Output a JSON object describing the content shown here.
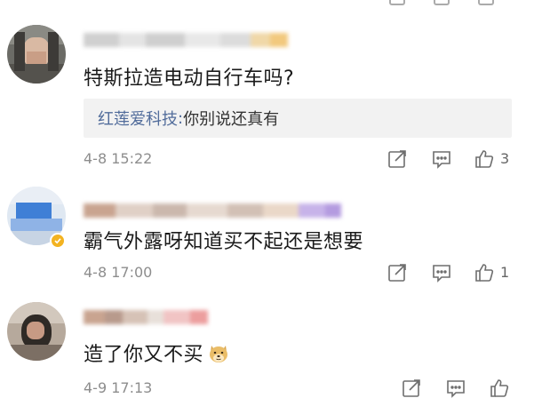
{
  "comments": [
    {
      "text": "特斯拉造电动自行车吗?",
      "reply": {
        "author": "红莲爱科技",
        "separator": ":",
        "text": " 你别说还真有"
      },
      "time": "4-8 15:22",
      "likes": "3"
    },
    {
      "text": "霸气外露呀知道买不起还是想要",
      "time": "4-8 17:00",
      "likes": "1"
    },
    {
      "text": "造了你又不买",
      "emoji": "doge-emoji",
      "time": "4-9 17:13",
      "likes": ""
    }
  ],
  "icons": {
    "share": "share-icon",
    "comment": "comment-icon",
    "like": "thumbs-up-icon",
    "verified": "verified-badge-icon"
  },
  "colors": {
    "accent_link": "#516c9b",
    "meta_gray": "#8d8d8d",
    "reply_bg": "#f2f2f2",
    "badge_gold": "#f3b321"
  }
}
